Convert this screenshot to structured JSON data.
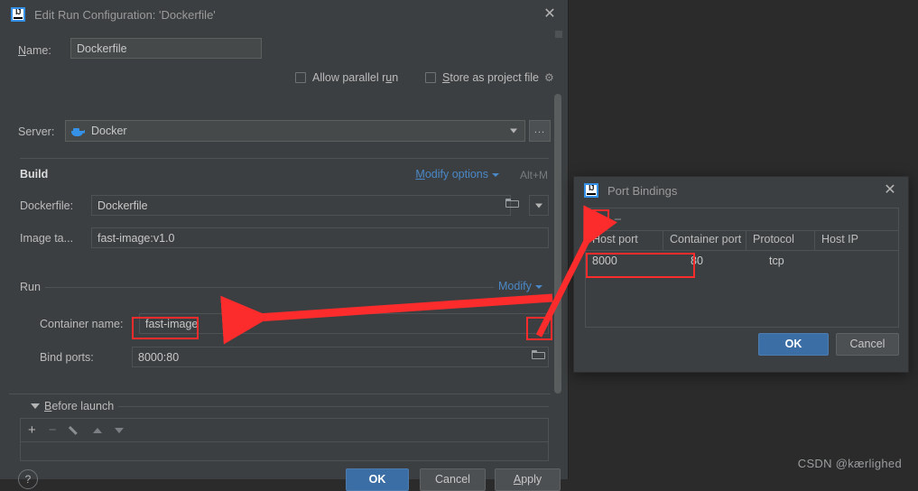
{
  "run_config_dialog": {
    "title": "Edit Run Configuration: 'Dockerfile'",
    "logo": "IJ",
    "close_label": "✕",
    "name_label": "Name:",
    "name_value": "Dockerfile",
    "allow_parallel_run_label": "Allow parallel run",
    "store_as_project_file_label": "Store as project file",
    "gear_icon": "⚙",
    "server_label": "Server:",
    "server_value": "Docker",
    "server_ellipsis_label": "...",
    "build": {
      "section_title": "Build",
      "modify_options_label": "Modify options",
      "modify_options_shortcut": "Alt+M",
      "dockerfile_label": "Dockerfile:",
      "dockerfile_value": "Dockerfile",
      "image_tag_label": "Image ta...",
      "image_tag_value": "fast-image:v1.0"
    },
    "run": {
      "section_title": "Run",
      "modify_label": "Modify",
      "container_name_label": "Container name:",
      "container_name_value": "fast-image",
      "bind_ports_label": "Bind ports:",
      "bind_ports_value": "8000:80"
    },
    "before_launch": {
      "title": "Before launch",
      "add_label": "+",
      "remove_label": "−",
      "edit_label": "edit-pencil",
      "move_up_label": "move-up",
      "move_down_label": "move-down"
    },
    "help_label": "?",
    "buttons": {
      "ok": "OK",
      "cancel": "Cancel",
      "apply": "Apply"
    }
  },
  "port_bindings_dialog": {
    "title": "Port Bindings",
    "logo": "IJ",
    "close_label": "✕",
    "toolbar": {
      "add_label": "+",
      "remove_label": "−"
    },
    "table": {
      "columns": [
        "Host port",
        "Container port",
        "Protocol",
        "Host IP"
      ],
      "rows": [
        {
          "host_port": "8000",
          "container_port": "80",
          "protocol": "tcp",
          "host_ip": ""
        }
      ]
    },
    "buttons": {
      "ok": "OK",
      "cancel": "Cancel"
    }
  },
  "watermark": "CSDN @kærlighed",
  "colors": {
    "dialog_bg": "#3c3f41",
    "desktop_bg": "#2b2b2b",
    "field_bg": "#45494a",
    "accent_blue": "#3b6ea5",
    "link_blue": "#4a88c7",
    "annotation_red": "#fc2c2c",
    "docker_blue": "#3592e8"
  }
}
